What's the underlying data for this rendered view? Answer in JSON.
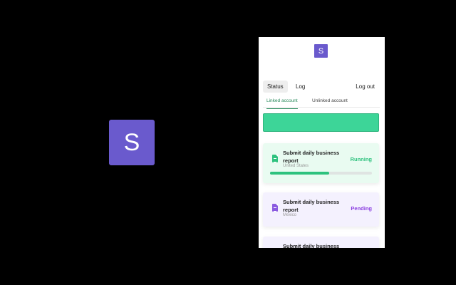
{
  "promo": {
    "logo_letter": "S"
  },
  "app": {
    "logo_letter": "S",
    "nav": {
      "status": "Status",
      "log": "Log",
      "logout": "Log out"
    },
    "sub_tabs": {
      "linked": "Linked account",
      "unlinked": "Unlinked account"
    },
    "colors": {
      "accent": "#6a5acd",
      "success": "#2ec27e",
      "pending": "#8a3ee0"
    },
    "cards": [
      {
        "title": "Submit daily business report",
        "country": "United States",
        "status": "Running",
        "progress": 0.58,
        "icon": "document-icon"
      },
      {
        "title": "Submit daily business report",
        "country": "Mexico",
        "status": "Pending",
        "icon": "document-icon"
      },
      {
        "title": "Submit daily business report",
        "icon": "document-icon"
      }
    ]
  }
}
